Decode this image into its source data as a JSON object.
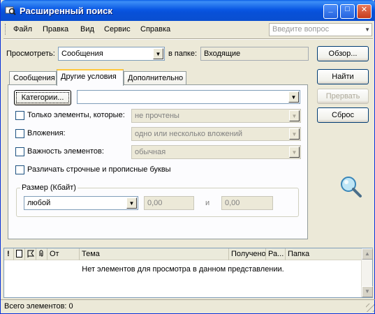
{
  "window": {
    "title": "Расширенный поиск",
    "minimize": "_",
    "maximize": "□",
    "close": "✕"
  },
  "menu": {
    "items": [
      "Файл",
      "Правка",
      "Вид",
      "Сервис",
      "Справка"
    ],
    "help_placeholder": "Введите вопрос"
  },
  "search": {
    "look_for_label": "Просмотреть:",
    "look_for_value": "Сообщения",
    "in_folder_label": "в папке:",
    "in_folder_value": "Входящие",
    "browse": "Обзор..."
  },
  "buttons": {
    "find": "Найти",
    "stop": "Прервать",
    "reset": "Сброс"
  },
  "tabs": [
    {
      "label": "Сообщения",
      "active": false
    },
    {
      "label": "Другие условия",
      "active": true
    },
    {
      "label": "Дополнительно",
      "active": false
    }
  ],
  "other": {
    "categories_button": "Категории...",
    "categories_value": "",
    "only_items_label": "Только элементы, которые:",
    "only_items_value": "не прочтены",
    "attachments_label": "Вложения:",
    "attachments_value": "одно или несколько вложений",
    "importance_label": "Важность элементов:",
    "importance_value": "обычная",
    "match_case_label": "Различать строчные и прописные буквы",
    "size_group_label": "Размер (Кбайт)",
    "size_mode": "любой",
    "size_from": "0,00",
    "size_and": "и",
    "size_to": "0,00"
  },
  "results": {
    "columns": [
      "!",
      "",
      "",
      "",
      "От",
      "Тема",
      "Получено",
      "Ра...",
      "Папка"
    ],
    "empty_message": "Нет элементов для просмотра в данном представлении."
  },
  "status": {
    "text": "Всего элементов: 0"
  }
}
